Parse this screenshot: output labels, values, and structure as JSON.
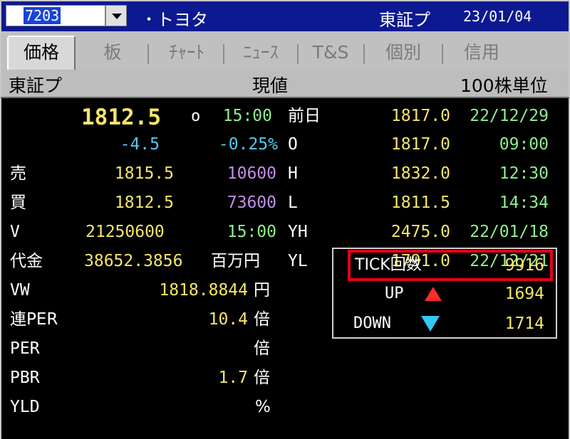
{
  "titlebar": {
    "code_value": "7203",
    "dash": "・",
    "name": "トヨタ",
    "exchange": "東証プ",
    "date": "23/01/04"
  },
  "tabs": [
    {
      "label": "価格",
      "active": true
    },
    {
      "label": "板"
    },
    {
      "label": "ﾁｬｰﾄ"
    },
    {
      "label": "ﾆｭｰｽ"
    },
    {
      "label": "T&S"
    },
    {
      "label": "個別"
    },
    {
      "label": "信用"
    }
  ],
  "header": {
    "exchange": "東証プ",
    "title": "現値",
    "unit": "100株単位"
  },
  "price": {
    "current": "1812.5",
    "marker": "o",
    "time": "15:00",
    "change": "-4.5",
    "change_pct": "-0.25%"
  },
  "rows": {
    "ask_label": "売",
    "ask_price": "1815.5",
    "ask_qty": "10600",
    "bid_label": "買",
    "bid_price": "1812.5",
    "bid_qty": "73600",
    "volume_label": "V",
    "volume": "21250600",
    "volume_time": "15:00",
    "turnover_label": "代金",
    "turnover": "38652.3856",
    "turnover_unit": "百万円",
    "vwap_label": "VW",
    "vwap": "1818.8844",
    "vwap_unit": "円",
    "per_cons_label": "連PER",
    "per_cons": "10.4",
    "per_cons_unit": "倍",
    "per_label": "PER",
    "per": "",
    "per_unit": "倍",
    "pbr_label": "PBR",
    "pbr": "1.7",
    "pbr_unit": "倍",
    "yld_label": "YLD",
    "yld": "",
    "yld_unit": "%"
  },
  "stats": [
    {
      "label": "前日",
      "price": "1817.0",
      "when": "22/12/29"
    },
    {
      "label": "O",
      "price": "1817.0",
      "when": "09:00"
    },
    {
      "label": "H",
      "price": "1832.0",
      "when": "12:30"
    },
    {
      "label": "L",
      "price": "1811.5",
      "when": "14:34"
    },
    {
      "label": "YH",
      "price": "2475.0",
      "when": "22/01/18"
    },
    {
      "label": "YL",
      "price": "1791.0",
      "when": "22/12/21"
    }
  ],
  "tick": {
    "count_label": "TICK回数",
    "count": "9916",
    "up_label": "UP",
    "up": "1694",
    "down_label": "DOWN",
    "down": "1714"
  },
  "colors": {
    "title_bg": "#0c1990",
    "price": "#f5e66a",
    "time": "#8df08d",
    "change": "#57c8ee",
    "qty": "#c38de9",
    "highlight": "#e8001a",
    "up": "#ff2a2a",
    "down": "#33c8f0"
  }
}
